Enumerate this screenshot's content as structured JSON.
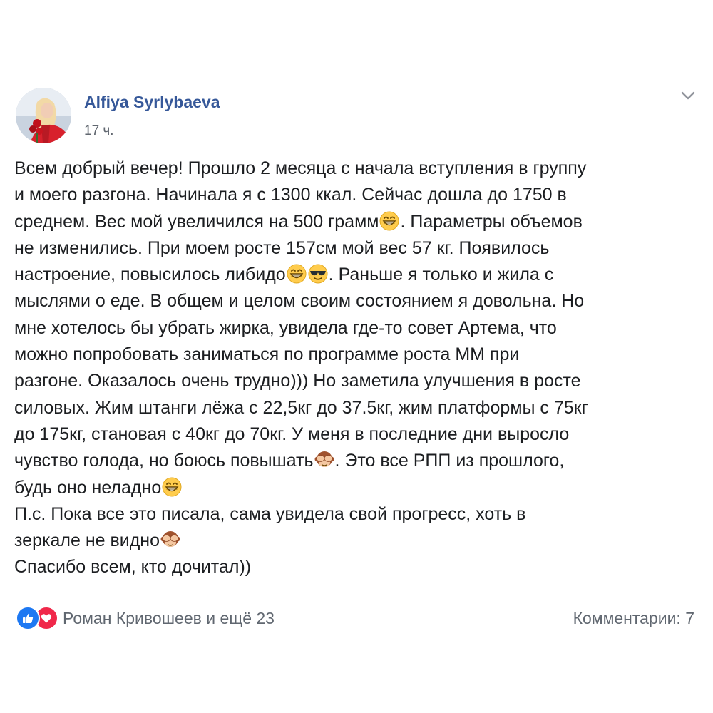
{
  "post": {
    "author": "Alfiya Syrlybaeva",
    "time": "17 ч.",
    "icons": {
      "menu": "chevron-down-icon",
      "grin": "grinning-face-emoji",
      "cool": "smiling-face-with-sunglasses-emoji",
      "monkey": "see-no-evil-monkey-emoji"
    },
    "text_lines": [
      [
        "Всем добрый вечер! Прошло 2 месяца с начала вступления в группу"
      ],
      [
        "и моего разгона. Начинала я с 1300 ккал. Сейчас дошла до 1750 в"
      ],
      [
        "среднем. Вес мой увеличился на 500 грамм",
        ". Параметры объемов"
      ],
      [
        "не изменились. При моем росте 157см мой вес 57 кг. Появилось"
      ],
      [
        "настроение, повысилось либидо",
        ". Раньше я только и жила с"
      ],
      [
        "мыслями о еде. В общем и целом своим состоянием я довольна. Но"
      ],
      [
        "мне хотелось бы убрать жирка, увидела где-то совет Артема, что"
      ],
      [
        "можно попробовать заниматься по программе роста ММ при"
      ],
      [
        "разгоне. Оказалось очень трудно))) Но заметила улучшения в росте"
      ],
      [
        "силовых. Жим штанги лёжа с 22,5кг до 37.5кг, жим платформы с 75кг"
      ],
      [
        "до 175кг, становая с 40кг до 70кг. У меня в последние дни выросло"
      ],
      [
        "чувство голода, но боюсь повышать",
        ". Это все РПП из прошлого,"
      ],
      [
        "будь оно неладно"
      ],
      [
        "П.с. Пока все это писала, сама увидела свой прогресс, хоть в"
      ],
      [
        "зеркале не видно"
      ],
      [
        "Спасибо всем, кто дочитал))"
      ]
    ],
    "reactions": {
      "icons": [
        "like-icon",
        "love-icon"
      ],
      "summary": "Роман Кривошеев и ещё 23"
    },
    "comments_label": "Комментарии: 7"
  },
  "colors": {
    "author": "#365899",
    "text": "#1c1e21",
    "meta": "#616770",
    "like": "#1d78f2",
    "love": "#f0284a"
  }
}
